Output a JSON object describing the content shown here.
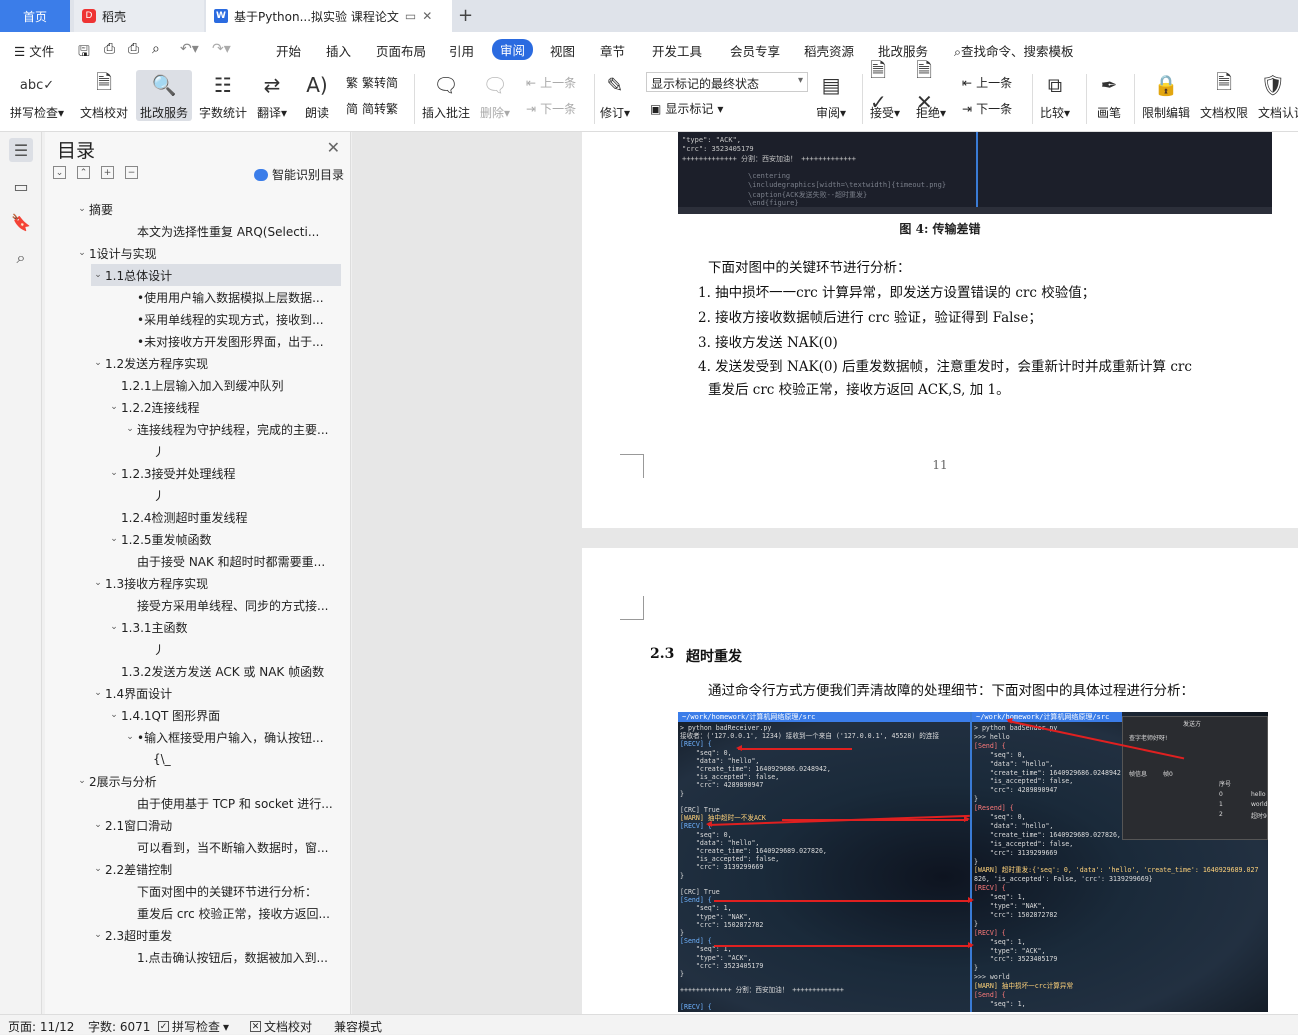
{
  "tabs": {
    "home": "首页",
    "daoke": "稻壳",
    "doc": "基于Python...拟实验 课程论文"
  },
  "menu": {
    "file": "文件",
    "items": [
      "开始",
      "插入",
      "页面布局",
      "引用",
      "审阅",
      "视图",
      "章节",
      "开发工具",
      "会员专享",
      "稻壳资源",
      "批改服务"
    ],
    "active": "审阅",
    "search": "查找命令、搜索模板"
  },
  "ribbon": {
    "spellcheck": "拼写检查",
    "doccheck": "文档校对",
    "correct": "批改服务",
    "wordcount": "字数统计",
    "translate": "翻译",
    "read": "朗读",
    "trad": "繁转简",
    "simp": "简转繁",
    "insert_comment": "插入批注",
    "delete": "删除",
    "prev": "上一条",
    "next": "下一条",
    "revise": "修订",
    "show_mode": "显示标记的最终状态",
    "show_marks": "显示标记",
    "review": "审阅",
    "accept": "接受",
    "reject": "拒绝",
    "prev2": "上一条",
    "next2": "下一条",
    "compare": "比较",
    "pen": "画笔",
    "restrict": "限制编辑",
    "rights": "文档权限",
    "cert": "文档认证"
  },
  "toc": {
    "title": "目录",
    "smart": "智能识别目录",
    "items": [
      {
        "text": "摘要",
        "level": 1,
        "arrow": "v"
      },
      {
        "text": "本文为选择性重复 ARQ(Selecti...",
        "level": 4,
        "arrow": ""
      },
      {
        "text": "1设计与实现",
        "level": 1,
        "arrow": "v"
      },
      {
        "text": "1.1总体设计",
        "level": 2,
        "arrow": "v",
        "selected": true
      },
      {
        "text": "•使用用户输入数据模拟上层数据...",
        "level": 4,
        "arrow": ""
      },
      {
        "text": "•采用单线程的实现方式，接收到...",
        "level": 4,
        "arrow": ""
      },
      {
        "text": "•未对接收方开发图形界面，出于...",
        "level": 4,
        "arrow": ""
      },
      {
        "text": "1.2发送方程序实现",
        "level": 2,
        "arrow": "v"
      },
      {
        "text": "1.2.1上层输入加入到缓冲队列",
        "level": 3,
        "arrow": ""
      },
      {
        "text": "1.2.2连接线程",
        "level": 3,
        "arrow": "v"
      },
      {
        "text": "连接线程为守护线程，完成的主要...",
        "level": 4,
        "arrow": "v"
      },
      {
        "text": "丿",
        "level": 5,
        "arrow": ""
      },
      {
        "text": "1.2.3接受并处理线程",
        "level": 3,
        "arrow": "v"
      },
      {
        "text": "丿",
        "level": 5,
        "arrow": ""
      },
      {
        "text": "1.2.4检测超时重发线程",
        "level": 3,
        "arrow": ""
      },
      {
        "text": "1.2.5重发帧函数",
        "level": 3,
        "arrow": "v"
      },
      {
        "text": "由于接受 NAK 和超时时都需要重...",
        "level": 4,
        "arrow": ""
      },
      {
        "text": "1.3接收方程序实现",
        "level": 2,
        "arrow": "v"
      },
      {
        "text": "接受方采用单线程、同步的方式接...",
        "level": 4,
        "arrow": ""
      },
      {
        "text": "1.3.1主函数",
        "level": 3,
        "arrow": "v"
      },
      {
        "text": "丿",
        "level": 5,
        "arrow": ""
      },
      {
        "text": "1.3.2发送方发送 ACK 或 NAK 帧函数",
        "level": 3,
        "arrow": ""
      },
      {
        "text": "1.4界面设计",
        "level": 2,
        "arrow": "v"
      },
      {
        "text": "1.4.1QT 图形界面",
        "level": 3,
        "arrow": "v"
      },
      {
        "text": "•输入框接受用户输入，确认按钮...",
        "level": 4,
        "arrow": "v"
      },
      {
        "text": "{\\_",
        "level": 5,
        "arrow": ""
      },
      {
        "text": "2展示与分析",
        "level": 1,
        "arrow": "v"
      },
      {
        "text": "由于使用基于 TCP 和 socket 进行...",
        "level": 4,
        "arrow": ""
      },
      {
        "text": "2.1窗口滑动",
        "level": 2,
        "arrow": "v"
      },
      {
        "text": "可以看到，当不断输入数据时，窗...",
        "level": 4,
        "arrow": ""
      },
      {
        "text": "2.2差错控制",
        "level": 2,
        "arrow": "v"
      },
      {
        "text": "下面对图中的关键环节进行分析：",
        "level": 4,
        "arrow": ""
      },
      {
        "text": "重发后 crc 校验正常，接收方返回...",
        "level": 4,
        "arrow": ""
      },
      {
        "text": "2.3超时重发",
        "level": 2,
        "arrow": "v"
      },
      {
        "text": "1.点击确认按钮后，数据被加入到...",
        "level": 4,
        "arrow": ""
      }
    ]
  },
  "page1": {
    "caption": "图 4: 传输差错",
    "intro": "下面对图中的关键环节进行分析：",
    "list": [
      "1.  抽中损坏一一crc 计算异常，即发送方设置错误的 crc 校验值；",
      "2.  接收方接收数据帧后进行 crc 验证，验证得到 False；",
      "3.  接收方发送 NAK(0)",
      "4.  发送发受到 NAK(0) 后重发数据帧，注意重发时，会重新计时并成重新计算 crc",
      "重发后 crc 校验正常，接收方返回 ACK,S, 加 1。"
    ],
    "page_number": "11",
    "term_lines": [
      "  \"type\": \"ACK\",",
      "  \"crc\": 3523405179",
      "+++++++++++++ 分割：西安加油！ +++++++++++++",
      "",
      "        \\centering",
      "        \\includegraphics[width=\\textwidth]{timeout.png}",
      "        \\caption{ACK发送失败--超时重发}",
      "        \\end{figure}"
    ]
  },
  "page2": {
    "heading_num": "2.3",
    "heading": "超时重发",
    "intro": "通过命令行方式方便我们弄清故障的处理细节：下面对图中的具体过程进行分析：",
    "left_header": "~/work/homework/计算机网络原理/src",
    "right_header": "~/work/homework/计算机网络原理/src",
    "left_lines": [
      "> python badReceiver.py",
      "接收者：('127.0.0.1', 1234) 接收到一个来自 ('127.0.0.1', 45528) 的连接",
      "[RECV] {",
      "    \"seq\": 0,",
      "    \"data\": \"hello\",",
      "    \"create_time\": 1640929686.0248942,",
      "    \"is_accepted\": false,",
      "    \"crc\": 4289890947",
      "}",
      "",
      "[CRC] True",
      "[WARN] 抽中超时一不发ACK",
      "[RECV] {",
      "    \"seq\": 0,",
      "    \"data\": \"hello\",",
      "    \"create_time\": 1640929689.027826,",
      "    \"is_accepted\": false,",
      "    \"crc\": 3139299669",
      "}",
      "",
      "[CRC] True",
      "[Send] {",
      "    \"seq\": 1,",
      "    \"type\": \"NAK\",",
      "    \"crc\": 1502872782",
      "}",
      "[Send] {",
      "    \"seq\": 1,",
      "    \"type\": \"ACK\",",
      "    \"crc\": 3523405179",
      "}",
      "",
      "+++++++++++++ 分割：西安加油！ +++++++++++++",
      "",
      "[RECV] {"
    ],
    "right_lines": [
      "> python badSender.py",
      ">>> hello",
      "[Send] {",
      "    \"seq\": 0,",
      "    \"data\": \"hello\",",
      "    \"create_time\": 1640929686.0248942,",
      "    \"is_accepted\": false,",
      "    \"crc\": 4289890947",
      "}",
      "[Resend] {",
      "    \"seq\": 0,",
      "    \"data\": \"hello\",",
      "    \"create_time\": 1640929689.027826,",
      "    \"is_accepted\": false,",
      "    \"crc\": 3139299669",
      "}",
      "[WARN] 超时重发:{'seq': 0, 'data': 'hello', 'create_time': 1640929689.027",
      "826, 'is_accepted': False, 'crc': 3139299669}",
      "[RECV] {",
      "    \"seq\": 1,",
      "    \"type\": \"NAK\",",
      "    \"crc\": 1502872782",
      "}",
      "[RECV] {",
      "    \"seq\": 1,",
      "    \"type\": \"ACK\",",
      "    \"crc\": 3523405179",
      "}",
      ">>> world",
      "[WARN] 抽中损坏一crc计算异常",
      "[Send] {",
      "    \"seq\": 1,"
    ],
    "dialog_title": "发送方",
    "dialog_lines": [
      "查字老师好呀!",
      "帧信息",
      "帧0",
      "序号",
      "0",
      "1",
      "2",
      "hello",
      "world",
      "超时9"
    ]
  },
  "status": {
    "page": "页面: 11/12",
    "words": "字数: 6071",
    "spell": "拼写检查",
    "proof": "文档校对",
    "compat": "兼容模式"
  }
}
